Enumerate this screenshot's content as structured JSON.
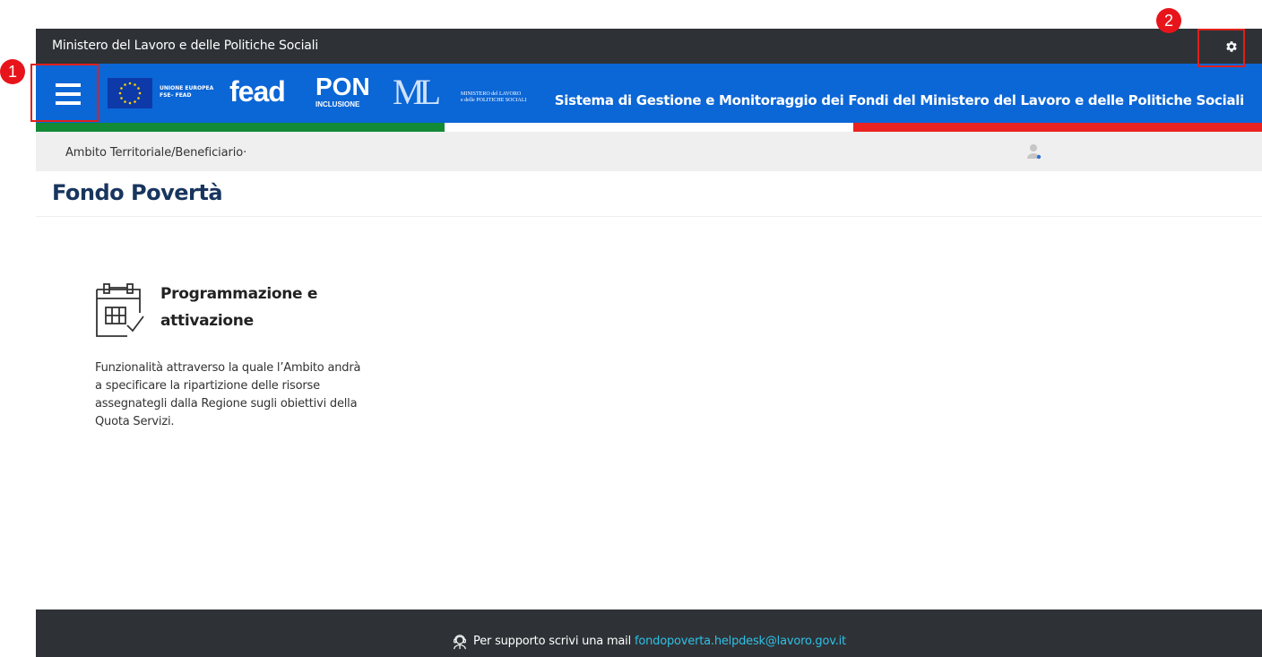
{
  "topbar": {
    "title": "Ministero del Lavoro e delle Politiche Sociali"
  },
  "header": {
    "title": "Sistema di Gestione e Monitoraggio dei Fondi del Ministero del Lavoro e delle Politiche Sociali",
    "logos": {
      "eu_line1": "UNIONE EUROPEA",
      "eu_line2": "FSE– FEAD",
      "fead": "fead",
      "pon": "PON",
      "pon_sub": "INCLUSIONE",
      "ministry_mark": "ML",
      "ministry_line1": "MINISTERO del LAVORO",
      "ministry_line2": "e delle POLITICHE SOCIALI"
    }
  },
  "breadcrumb": {
    "text": "Ambito Territoriale/Beneficiario·"
  },
  "page": {
    "title": "Fondo Povertà"
  },
  "card": {
    "title_line1": "Programmazione e",
    "title_line2": "attivazione",
    "desc_line1": "Funzionalità attraverso la quale l’Ambito andrà",
    "desc_line2": "a specificare la ripartizione delle risorse",
    "desc_line3": "assegnategli dalla Regione sugli obiettivi della",
    "desc_line4": "Quota Servizi."
  },
  "footer": {
    "text": "Per supporto scrivi una mail",
    "email": "fondopoverta.helpdesk@lavoro.gov.it"
  },
  "annotations": {
    "badge1": "1",
    "badge2": "2"
  },
  "colors": {
    "topbar": "#2e3236",
    "header": "#0b66d6",
    "title": "#18355e",
    "link": "#2fc0e6",
    "annotation": "#e8141b"
  }
}
